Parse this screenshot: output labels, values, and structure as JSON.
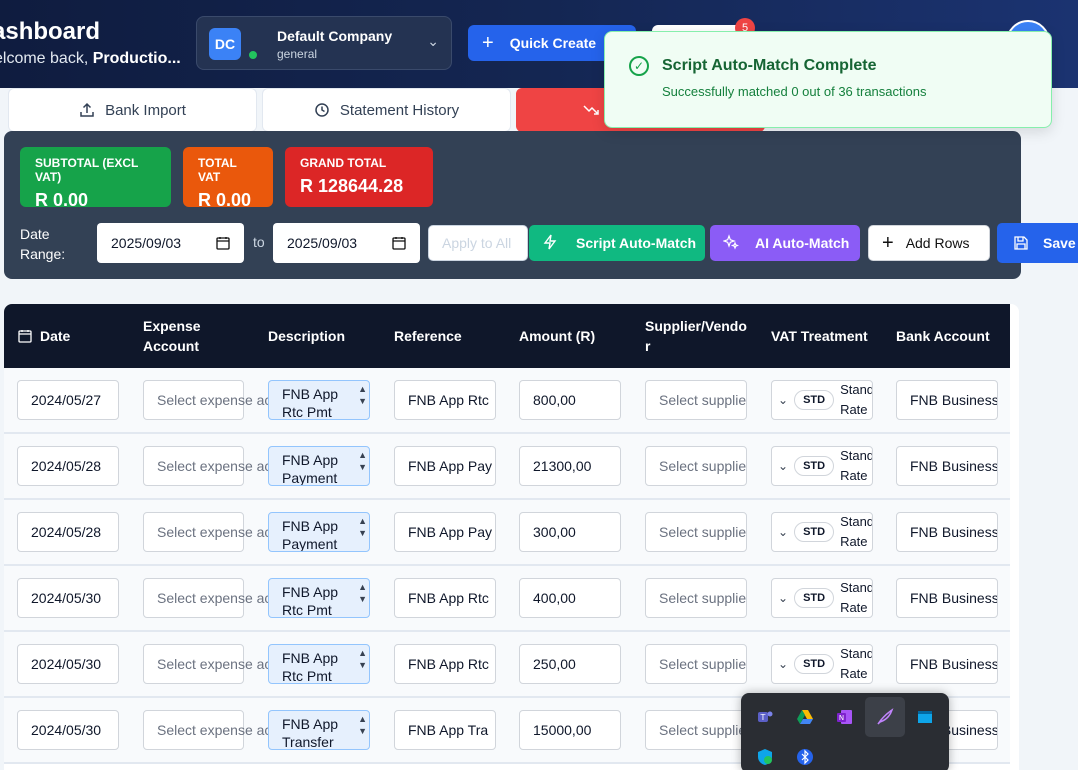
{
  "header": {
    "title": "ashboard",
    "welcome_prefix": "elcome back, ",
    "welcome_name": "Productio...",
    "company": {
      "initials": "DC",
      "name": "Default Company",
      "type": "general"
    },
    "quick_create": "Quick Create",
    "notification_count": "5"
  },
  "tabs": [
    {
      "label": "Bank Import",
      "icon": "upload-icon"
    },
    {
      "label": "Statement History",
      "icon": "history-icon"
    },
    {
      "label": "",
      "icon": "trend-down-icon"
    }
  ],
  "summary": {
    "subtotal_label": "SUBTOTAL (EXCL VAT)",
    "subtotal_value": "R 0.00",
    "vat_label": "TOTAL VAT",
    "vat_value": "R 0.00",
    "grand_label": "GRAND TOTAL",
    "grand_value": "R 128644.28"
  },
  "date_range": {
    "label_1": "Date",
    "label_2": "Range:",
    "from": "2025/09/03",
    "to_label": "to",
    "to": "2025/09/03"
  },
  "actions": {
    "apply_all": "Apply to All",
    "script_match": "Script Auto-Match",
    "ai_match": "AI Auto-Match",
    "add_rows": "Add Rows",
    "save": "Save"
  },
  "table": {
    "headers": [
      "Date",
      "Expense Account",
      "Description",
      "Reference",
      "Amount (R)",
      "Supplier/Vendor",
      "VAT Treatment",
      "Bank Account"
    ],
    "placeholders": {
      "expense": "Select expense account...",
      "supplier": "Select supplier..."
    },
    "vat_pill": "STD",
    "vat_text": "Standard Rate",
    "rows": [
      {
        "date": "2024/05/27",
        "desc_1": "FNB App",
        "desc_2": "Rtc Pmt",
        "reference": "FNB App Rtc",
        "amount": "800,00",
        "bank": "FNB Business Current"
      },
      {
        "date": "2024/05/28",
        "desc_1": "FNB App",
        "desc_2": "Payment",
        "reference": "FNB App Pay",
        "amount": "21300,00",
        "bank": "FNB Business Current"
      },
      {
        "date": "2024/05/28",
        "desc_1": "FNB App",
        "desc_2": "Payment",
        "reference": "FNB App Pay",
        "amount": "300,00",
        "bank": "FNB Business Current"
      },
      {
        "date": "2024/05/30",
        "desc_1": "FNB App",
        "desc_2": "Rtc Pmt",
        "reference": "FNB App Rtc",
        "amount": "400,00",
        "bank": "FNB Business Current"
      },
      {
        "date": "2024/05/30",
        "desc_1": "FNB App",
        "desc_2": "Rtc Pmt",
        "reference": "FNB App Rtc",
        "amount": "250,00",
        "bank": "FNB Business Current"
      },
      {
        "date": "2024/05/30",
        "desc_1": "FNB App",
        "desc_2": "Transfer",
        "reference": "FNB App Tra",
        "amount": "15000,00",
        "bank": "FNB Business Current"
      }
    ]
  },
  "toast": {
    "title": "Script Auto-Match Complete",
    "message": "Successfully matched 0 out of 36 transactions"
  },
  "tray_icons": [
    "teams-icon",
    "google-drive-icon",
    "onenote-icon",
    "feather-icon",
    "window-icon",
    "shield-icon",
    "bluetooth-icon"
  ]
}
